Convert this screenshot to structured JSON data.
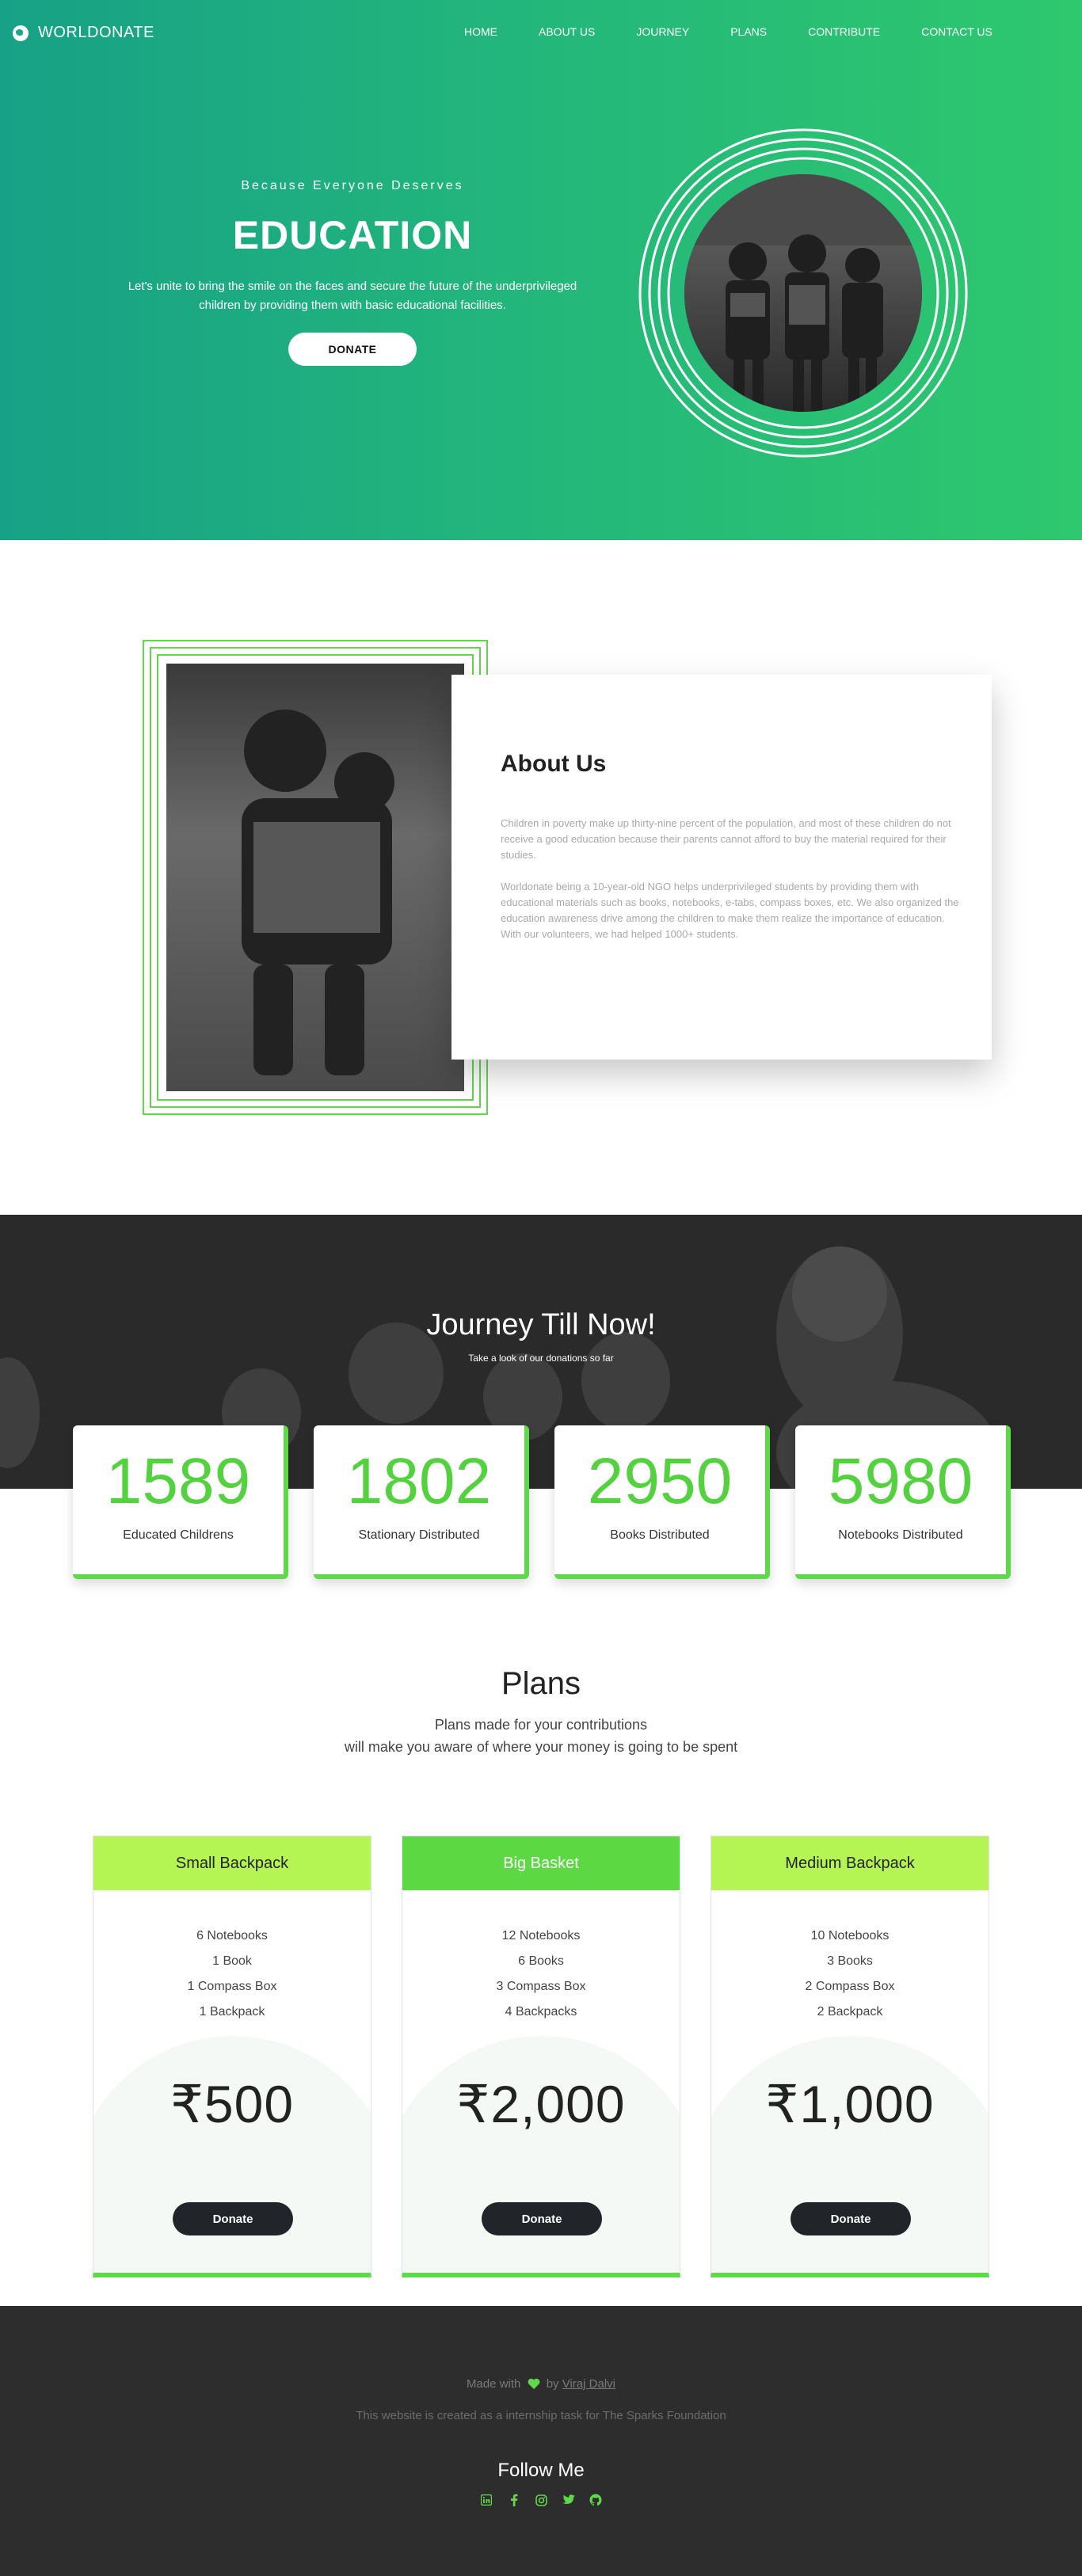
{
  "nav": {
    "brand": "WORLDONATE",
    "links": [
      "HOME",
      "ABOUT US",
      "JOURNEY",
      "PLANS",
      "CONTRIBUTE",
      "CONTACT US"
    ]
  },
  "hero": {
    "subtitle": "Because Everyone Deserves",
    "title": "EDUCATION",
    "text": "Let's unite to bring the smile on the faces and secure the future of the underprivileged children by providing them with basic educational facilities.",
    "button": "DONATE"
  },
  "about": {
    "title": "About Us",
    "p1": "Children in poverty make up thirty-nine percent of the population, and most of these children do not receive a good education because their parents cannot afford to buy the material required for their studies.",
    "p2": "Worldonate being a 10-year-old NGO helps underprivileged students by providing them with educational materials such as books, notebooks, e-tabs, compass boxes, etc. We also organized the education awareness drive among the children to make them realize the importance of education. With our volunteers, we had helped 1000+ students."
  },
  "journey": {
    "title": "Journey Till Now!",
    "subtitle": "Take a look of our donations so far",
    "stats": [
      {
        "value": "1589",
        "label": "Educated Childrens"
      },
      {
        "value": "1802",
        "label": "Stationary Distributed"
      },
      {
        "value": "2950",
        "label": "Books Distributed"
      },
      {
        "value": "5980",
        "label": "Notebooks Distributed"
      }
    ]
  },
  "plans": {
    "title": "Plans",
    "subtitle_line1": "Plans made for your contributions",
    "subtitle_line2": "will make you aware of where your money is going to be spent",
    "cards": [
      {
        "name": "Small Backpack",
        "items": [
          "6 Notebooks",
          "1 Book",
          "1 Compass Box",
          "1 Backpack"
        ],
        "price": "₹500",
        "button": "Donate",
        "header_color": "#b5f553",
        "text_color": "#222222"
      },
      {
        "name": "Big Basket",
        "items": [
          "12 Notebooks",
          "6 Books",
          "3 Compass Box",
          "4 Backpacks"
        ],
        "price": "₹2,000",
        "button": "Donate",
        "header_color": "#5cd843",
        "text_color": "#ffffff"
      },
      {
        "name": "Medium Backpack",
        "items": [
          "10 Notebooks",
          "3 Books",
          "2 Compass Box",
          "2 Backpack"
        ],
        "price": "₹1,000",
        "button": "Donate",
        "header_color": "#b5f553",
        "text_color": "#222222"
      }
    ]
  },
  "footer": {
    "made_prefix": "Made with",
    "made_by": "by",
    "author": "Viraj Dalvi",
    "task": "This website is created as a internship task for The Sparks Foundation",
    "follow": "Follow Me",
    "social_icons": [
      "linkedin-icon",
      "facebook-icon",
      "instagram-icon",
      "twitter-icon",
      "github-icon"
    ]
  },
  "colors": {
    "accent_green": "#5fd84a",
    "hero_gradient_start": "#17a186",
    "hero_gradient_end": "#2ec86e",
    "footer_bg": "#2d2d2d"
  }
}
